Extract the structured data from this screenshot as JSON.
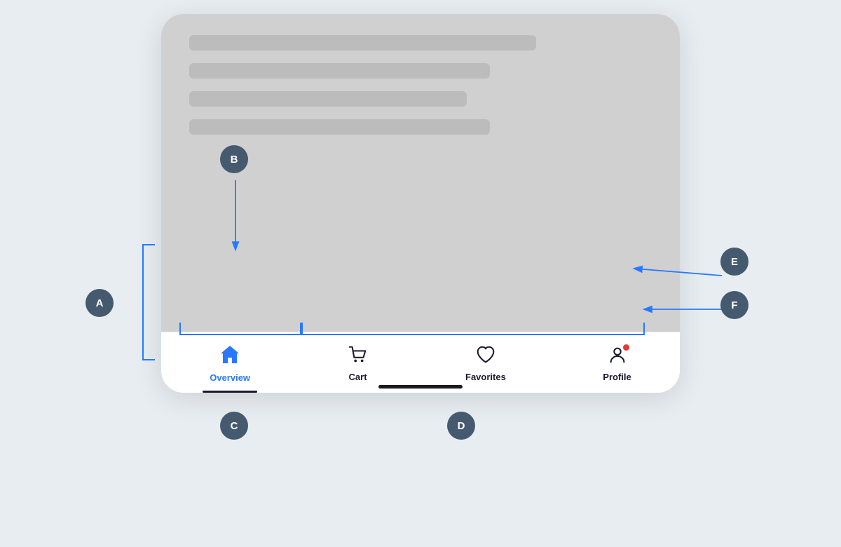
{
  "annotations": {
    "a": "A",
    "b": "B",
    "c": "C",
    "d": "D",
    "e": "E",
    "f": "F"
  },
  "nav": {
    "overview_label": "Overview",
    "cart_label": "Cart",
    "favorites_label": "Favorites",
    "profile_label": "Profile"
  },
  "skeleton": {
    "bar1_width": "75%",
    "bar2_width": "65%",
    "bar3_width": "60%",
    "bar4_width": "65%"
  }
}
